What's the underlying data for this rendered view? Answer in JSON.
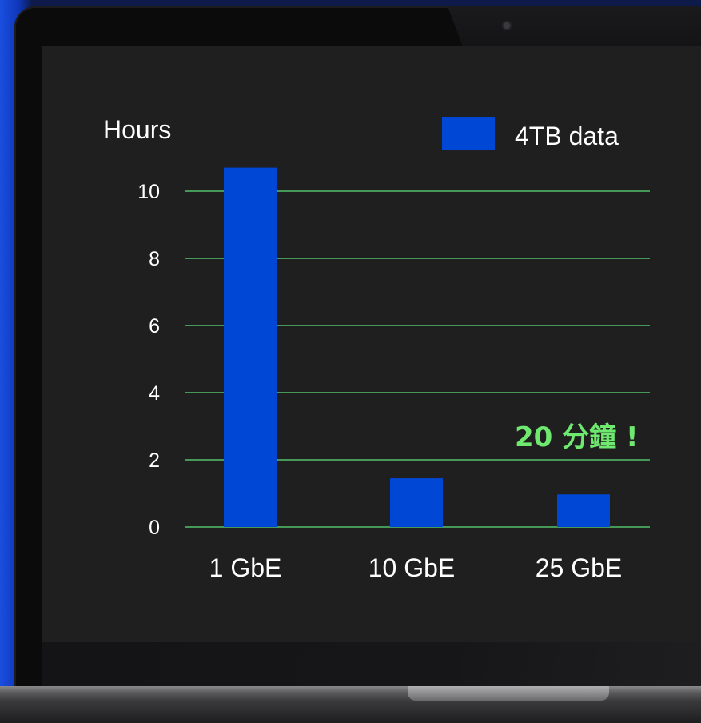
{
  "chart_data": {
    "type": "bar",
    "title": "",
    "ylabel": "Hours",
    "xlabel": "",
    "categories": [
      "1 GbE",
      "10 GbE",
      "25 GbE"
    ],
    "series": [
      {
        "name": "4TB data",
        "values": [
          10.7,
          1.45,
          0.97
        ],
        "color": "#0047d6"
      }
    ],
    "ylim": [
      0,
      10
    ],
    "yticks": [
      0,
      2,
      4,
      6,
      8,
      10
    ],
    "grid": true,
    "grid_color": "#5ee07a",
    "legend_position": "top-right",
    "annotation": "20 分鐘 !",
    "annotation_color": "#6fe86f"
  }
}
